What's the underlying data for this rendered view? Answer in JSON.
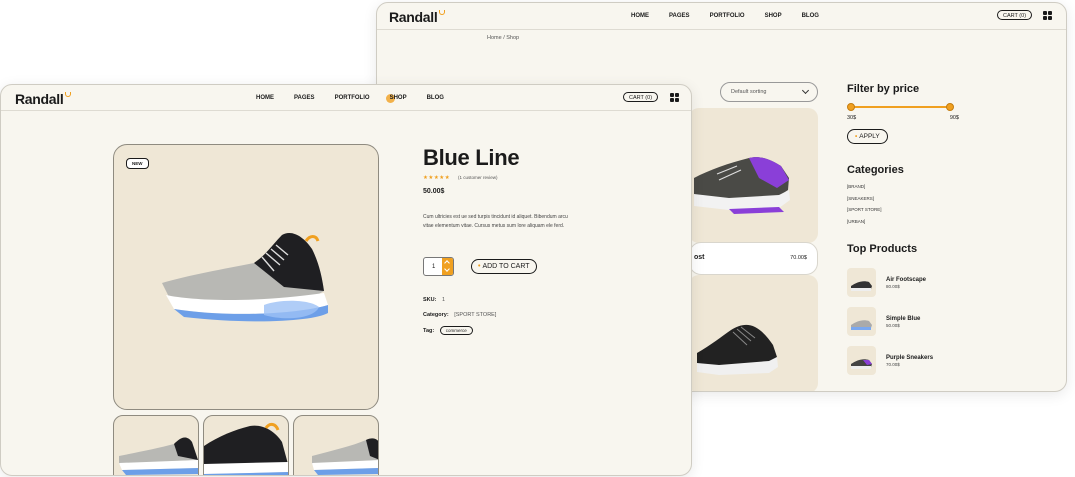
{
  "colors": {
    "accent": "#f0a020",
    "background": "#f8f6ef",
    "card": "#efe7d6",
    "text": "#1b1b1b"
  },
  "back": {
    "logo": "Randall",
    "nav": [
      "HOME",
      "PAGES",
      "PORTFOLIO",
      "SHOP",
      "BLOG"
    ],
    "cart": "CART (0)",
    "breadcrumb": "Home / Shop",
    "sort_label": "Default sorting",
    "product_bar": {
      "name": "ost",
      "price": "70.00$"
    },
    "filter": {
      "title": "Filter by price",
      "min": "30$",
      "max": "90$",
      "apply": "APPLY"
    },
    "categories": {
      "title": "Categories",
      "items": [
        "[BRAND]",
        "[SNEAKERS]",
        "[SPORT STORE]",
        "[URBAN]"
      ]
    },
    "top_products": {
      "title": "Top Products",
      "items": [
        {
          "name": "Air Footscape",
          "price": "80.00$"
        },
        {
          "name": "Simple Blue",
          "price": "50.00$"
        },
        {
          "name": "Purple Sneakers",
          "price": "70.00$"
        }
      ]
    }
  },
  "front": {
    "logo": "Randall",
    "nav": [
      "HOME",
      "PAGES",
      "PORTFOLIO",
      "SHOP",
      "BLOG"
    ],
    "active_nav": "SHOP",
    "cart": "CART (0)",
    "new_badge": "NEW",
    "product": {
      "title": "Blue Line",
      "stars": "★★★★★",
      "rating_fraction": 1.0,
      "reviews": "(1 customer review)",
      "price": "50.00$",
      "description": "Cum ultricies est ue sed turpis tincidunt id aliquet. Bibendum arcu vitae elementum vitae. Cursus metus sum lore aliquam ele ferd.",
      "quantity": "1",
      "add_to_cart": "ADD TO CART",
      "sku_label": "SKU:",
      "sku": "1",
      "category_label": "Category:",
      "category": "[SPORT STORE]",
      "tag_label": "Tag:",
      "tag": "commerce"
    }
  }
}
